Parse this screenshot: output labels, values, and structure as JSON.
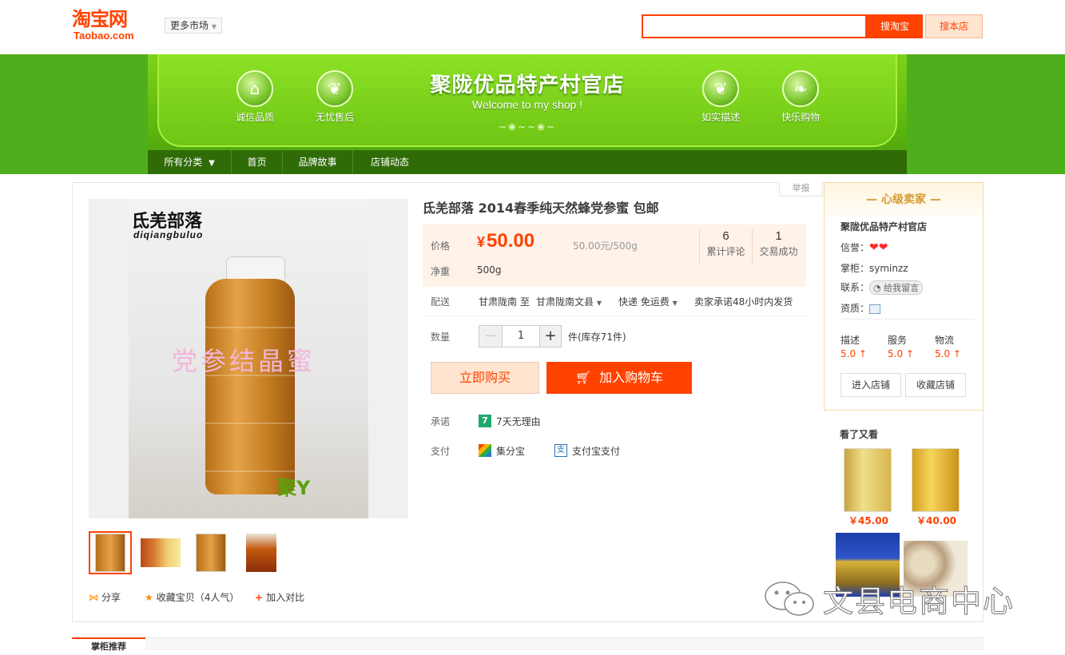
{
  "header": {
    "logo_cn": "淘宝网",
    "logo_en": "Taobao.com",
    "more_market": "更多市场",
    "search_placeholder": "",
    "search_taobao": "搜淘宝",
    "search_shop": "搜本店"
  },
  "banner": {
    "shop_name": "聚陇优品特产村官店",
    "welcome": "Welcome to my shop !",
    "badges": [
      "诚信品质",
      "无忧售后",
      "如实描述",
      "快乐购物"
    ],
    "nav": [
      "所有分类",
      "首页",
      "品牌故事",
      "店铺动态"
    ]
  },
  "product": {
    "report": "举报",
    "title": "氐羌部落 2014春季纯天然蜂党参蜜 包邮",
    "price_label": "价格",
    "currency": "¥",
    "price": "50.00",
    "unit_price": "50.00元/500g",
    "reviews_count": "6",
    "reviews_label": "累计评论",
    "deals_count": "1",
    "deals_label": "交易成功",
    "weight_label": "净重",
    "weight_value": "500g",
    "delivery_label": "配送",
    "delivery_from": "甘肃陇南",
    "delivery_to_word": "至",
    "delivery_to": "甘肃陇南文县",
    "shipping": "快递 免运费",
    "ship_promise": "卖家承诺48小时内发货",
    "qty_label": "数量",
    "qty_value": "1",
    "stock": "件(库存71件)",
    "buy_now": "立即购买",
    "add_cart": "加入购物车",
    "promise_label": "承诺",
    "promise_value": "7天无理由",
    "pay_label": "支付",
    "pay_methods": [
      "集分宝",
      "支付宝支付"
    ],
    "image_brand": "氐羌部落",
    "image_brand_en": "diqiangbuluo",
    "image_watermark": "党参结晶蜜"
  },
  "share": {
    "share": "分享",
    "favorite": "收藏宝贝（4人气）",
    "compare": "加入对比"
  },
  "seller": {
    "level": "心级卖家",
    "shop_name": "聚陇优品特产村官店",
    "credit_label": "信誉：",
    "keeper_label": "掌柜：",
    "keeper": "syminzz",
    "contact_label": "联系：",
    "contact_btn": "给我留言",
    "qual_label": "资质：",
    "ratings": [
      {
        "label": "描述",
        "value": "5.0"
      },
      {
        "label": "服务",
        "value": "5.0"
      },
      {
        "label": "物流",
        "value": "5.0"
      }
    ],
    "enter_shop": "进入店铺",
    "fav_shop": "收藏店铺"
  },
  "also_viewed": {
    "title": "看了又看",
    "items": [
      {
        "price": "￥45.00"
      },
      {
        "price": "￥40.00"
      }
    ]
  },
  "bottom_tab": "掌柜推荐",
  "watermark_text": "文县电商中心",
  "colors": {
    "accent": "#ff4200",
    "banner_green": "#6ec513",
    "nav_dark": "#2f6b07"
  }
}
